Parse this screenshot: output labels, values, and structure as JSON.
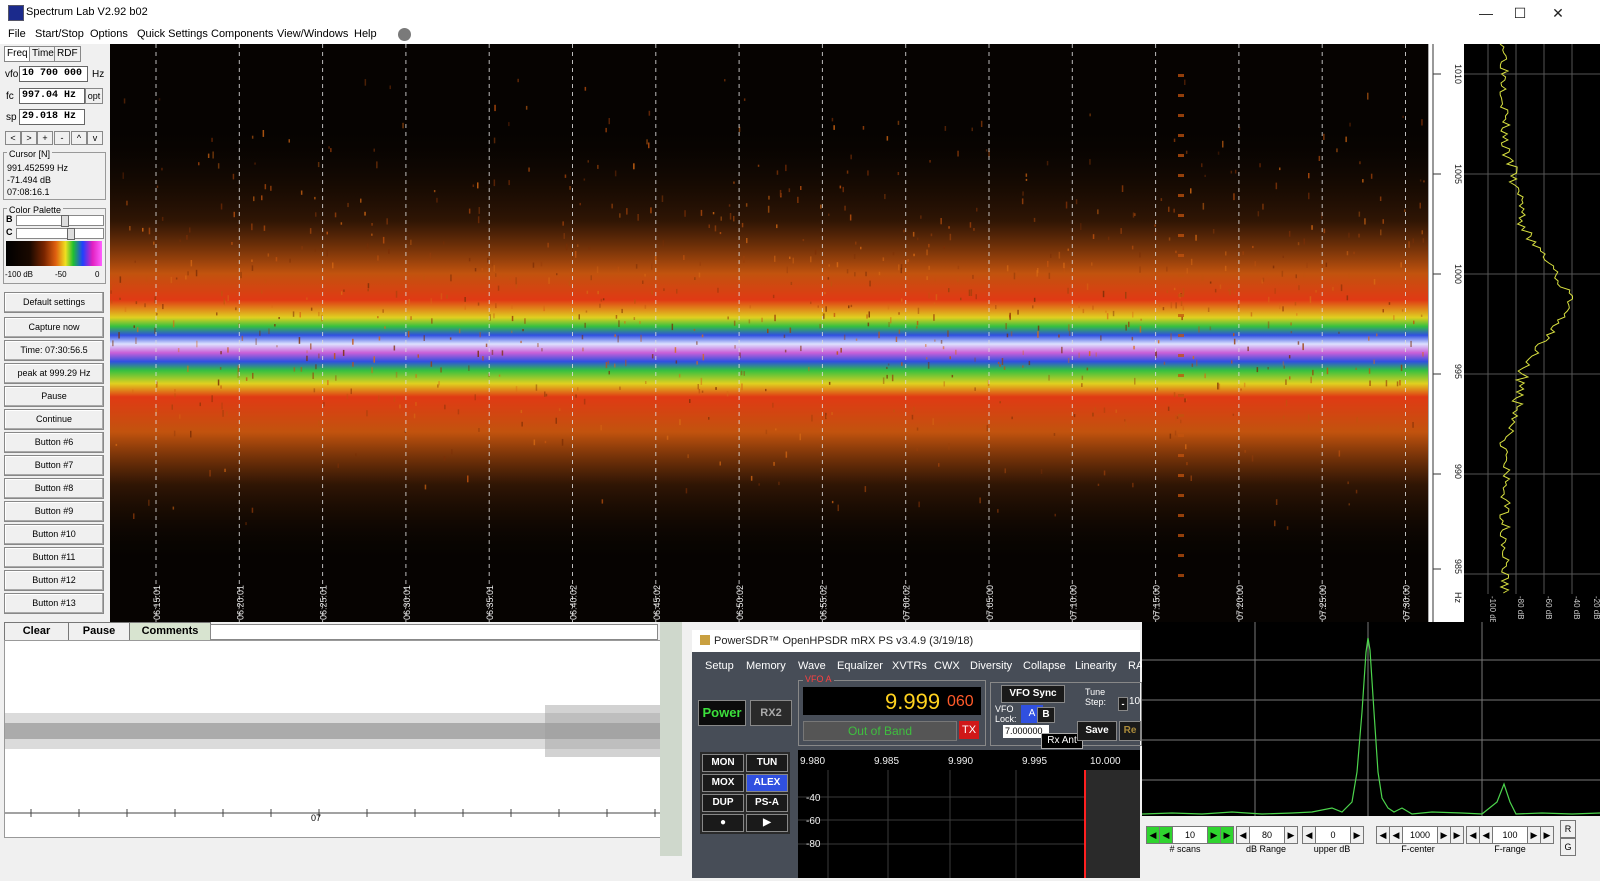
{
  "window": {
    "title": "Spectrum Lab V2.92 b02"
  },
  "window_controls": {
    "minimize": "—",
    "maximize": "☐",
    "close": "✕"
  },
  "menu": [
    "File",
    "Start/Stop",
    "Options",
    "Quick Settings",
    "Components",
    "View/Windows",
    "Help"
  ],
  "left_panel": {
    "tabs": [
      "Freq",
      "Time",
      "RDF"
    ],
    "vfo_label": "vfo",
    "vfo_value": "10 700 000",
    "vfo_unit": "Hz",
    "fc_label": "fc",
    "fc_value": "997.04 Hz",
    "fc_opt": "opt",
    "sp_label": "sp",
    "sp_value": "29.018 Hz",
    "nav_buttons": [
      "<",
      ">",
      "+",
      "-",
      "^",
      "v"
    ],
    "cursor": {
      "title": "Cursor [N]",
      "freq": "991.452599 Hz",
      "level": "-71.494 dB",
      "time": "07:08:16.1"
    },
    "palette": {
      "title": "Color Palette",
      "b_label": "B",
      "c_label": "C",
      "scale_min": "-100 dB",
      "scale_mid": "-50",
      "scale_max": "0"
    },
    "buttons": [
      "Default settings",
      "Capture now",
      "Time:  07:30:56.5",
      "peak at 999.29 Hz",
      "Pause",
      "Continue",
      "Button #6",
      "Button #7",
      "Button #8",
      "Button #9",
      "Button #10",
      "Button #11",
      "Button #12",
      "Button #13"
    ]
  },
  "waterfall": {
    "time_labels": [
      "06:15:01",
      "06:20:01",
      "06:25:01",
      "06:30:01",
      "06:35:01",
      "06:40:02",
      "06:45:02",
      "06:50:02",
      "06:55:02",
      "07:00:02",
      "07:05:00",
      "07:10:00",
      "07:15:00",
      "07:20:00",
      "07:25:00",
      "07:30:00"
    ],
    "freq_scale": [
      "1010",
      "1005",
      "1000",
      "995",
      "990",
      "985"
    ],
    "freq_unit": "Hz",
    "spectrum_db_labels": [
      "-100 dB",
      "-80 dB",
      "-60 dB",
      "-40 dB",
      "-20 dB"
    ]
  },
  "scope": {
    "buttons": [
      "Clear",
      "Pause",
      "Comments"
    ],
    "time_label": "07"
  },
  "powersdr": {
    "title": "PowerSDR™ OpenHPSDR mRX PS v3.4.9 (3/19/18)",
    "menu": [
      "Setup",
      "Memory",
      "Wave",
      "Equalizer",
      "XVTRs",
      "CWX",
      "Diversity",
      "Collapse",
      "Linearity",
      "RA"
    ],
    "power": "Power",
    "rx2": "RX2",
    "vfo_a_label": "VFO A",
    "freq_main": "9.999",
    "freq_sub": "060",
    "band_status": "Out of Band",
    "tx": "TX",
    "vfo_sync": "VFO Sync",
    "vfo_lock_label": "VFO Lock:",
    "lock_a": "A",
    "lock_b": "B",
    "tune_step_label": "Tune Step:",
    "tune_minus": "-",
    "tune_value": "10",
    "step_value": "7.000000",
    "rx_ant": "Rx Ant",
    "save": "Save",
    "re": "Re",
    "mode_buttons": [
      "MON",
      "TUN",
      "MOX",
      "ALEX",
      "DUP",
      "PS-A",
      "●",
      "▶"
    ],
    "pan_freqs": [
      "9.980",
      "9.985",
      "9.990",
      "9.995",
      "10.000"
    ],
    "pan_db": [
      "-40",
      "-60",
      "-80"
    ]
  },
  "right_spectrum": {
    "controls": [
      {
        "value": "10",
        "label": "# scans"
      },
      {
        "value": "80",
        "label": "dB Range"
      },
      {
        "value": "0",
        "label": "upper dB"
      },
      {
        "value": "1000",
        "label": "F-center"
      },
      {
        "value": "100",
        "label": "F-range"
      }
    ],
    "edge_labels": [
      "R",
      "G"
    ]
  },
  "colors": {
    "waterfall_bg": "#060301",
    "palette_orange": "#d65a10",
    "palette_green": "#39c840",
    "palette_blue": "#3050e0",
    "trace_green": "#6cc24a",
    "vfo_yellow": "#ffd21f",
    "vfo_red": "#ff5a2a",
    "out_of_band": "#3fbf3f"
  }
}
